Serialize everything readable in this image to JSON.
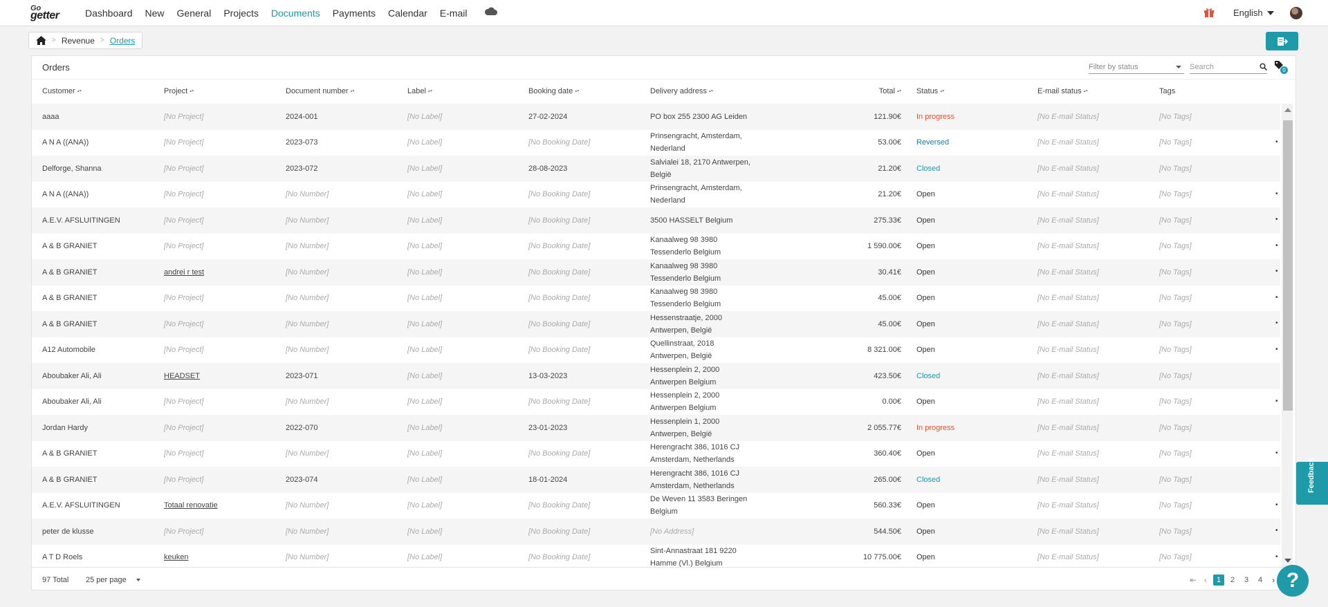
{
  "nav": {
    "logo_top": "Go",
    "logo_bottom": "getter",
    "items": [
      "Dashboard",
      "New",
      "General",
      "Projects",
      "Documents",
      "Payments",
      "Calendar",
      "E-mail"
    ],
    "active": "Documents",
    "language": "English"
  },
  "breadcrumb": {
    "items": [
      "Revenue",
      "Orders"
    ]
  },
  "panel": {
    "title": "Orders",
    "filter_placeholder": "Filter by status",
    "search_placeholder": "Search",
    "tag_filter_count": "0"
  },
  "columns": [
    "Customer",
    "Project",
    "Document number",
    "Label",
    "Booking date",
    "Delivery address",
    "Total",
    "Status",
    "E-mail status",
    "Tags"
  ],
  "rows": [
    {
      "customer": "aaaa",
      "project": "[No Project]",
      "project_link": false,
      "doc": "2024-001",
      "label": "[No Label]",
      "booking": "27-02-2024",
      "address": "PO box 255 2300 AG Leiden",
      "total": "121.90€",
      "status": "In progress",
      "email": "[No E-mail Status]",
      "tags": "[No Tags]",
      "mark": ""
    },
    {
      "customer": "A N A ((ANA))",
      "project": "[No Project]",
      "project_link": false,
      "doc": "2023-073",
      "label": "[No Label]",
      "booking": "[No Booking Date]",
      "address": "Prinsengracht, Amsterdam, Nederland",
      "total": "53.00€",
      "status": "Reversed",
      "email": "[No E-mail Status]",
      "tags": "[No Tags]",
      "mark": "•"
    },
    {
      "customer": "Delforge, Shanna",
      "project": "[No Project]",
      "project_link": false,
      "doc": "2023-072",
      "label": "[No Label]",
      "booking": "28-08-2023",
      "address": "Salvialei 18, 2170 Antwerpen, België",
      "total": "21.20€",
      "status": "Closed",
      "email": "[No E-mail Status]",
      "tags": "[No Tags]",
      "mark": ""
    },
    {
      "customer": "A N A ((ANA))",
      "project": "[No Project]",
      "project_link": false,
      "doc": "[No Number]",
      "label": "[No Label]",
      "booking": "[No Booking Date]",
      "address": "Prinsengracht, Amsterdam, Nederland",
      "total": "21.20€",
      "status": "Open",
      "email": "[No E-mail Status]",
      "tags": "[No Tags]",
      "mark": "•"
    },
    {
      "customer": "A.E.V. AFSLUITINGEN",
      "project": "[No Project]",
      "project_link": false,
      "doc": "[No Number]",
      "label": "[No Label]",
      "booking": "[No Booking Date]",
      "address": "3500 HASSELT Belgium",
      "total": "275.33€",
      "status": "Open",
      "email": "[No E-mail Status]",
      "tags": "[No Tags]",
      "mark": "•"
    },
    {
      "customer": "A & B GRANIET",
      "project": "[No Project]",
      "project_link": false,
      "doc": "[No Number]",
      "label": "[No Label]",
      "booking": "[No Booking Date]",
      "address": "Kanaalweg 98 3980 Tessenderlo Belgium",
      "total": "1 590.00€",
      "status": "Open",
      "email": "[No E-mail Status]",
      "tags": "[No Tags]",
      "mark": "•"
    },
    {
      "customer": "A & B GRANIET",
      "project": "andrei r test",
      "project_link": true,
      "doc": "[No Number]",
      "label": "[No Label]",
      "booking": "[No Booking Date]",
      "address": "Kanaalweg 98 3980 Tessenderlo Belgium",
      "total": "30.41€",
      "status": "Open",
      "email": "[No E-mail Status]",
      "tags": "[No Tags]",
      "mark": "•"
    },
    {
      "customer": "A & B GRANIET",
      "project": "[No Project]",
      "project_link": false,
      "doc": "[No Number]",
      "label": "[No Label]",
      "booking": "[No Booking Date]",
      "address": "Kanaalweg 98 3980 Tessenderlo Belgium",
      "total": "45.00€",
      "status": "Open",
      "email": "[No E-mail Status]",
      "tags": "[No Tags]",
      "mark": "•"
    },
    {
      "customer": "A & B GRANIET",
      "project": "[No Project]",
      "project_link": false,
      "doc": "[No Number]",
      "label": "[No Label]",
      "booking": "[No Booking Date]",
      "address": "Hessenstraatje, 2000 Antwerpen, België",
      "total": "45.00€",
      "status": "Open",
      "email": "[No E-mail Status]",
      "tags": "[No Tags]",
      "mark": "•"
    },
    {
      "customer": "A12 Automobile",
      "project": "[No Project]",
      "project_link": false,
      "doc": "[No Number]",
      "label": "[No Label]",
      "booking": "[No Booking Date]",
      "address": "Quellinstraat, 2018 Antwerpen, België",
      "total": "8 321.00€",
      "status": "Open",
      "email": "[No E-mail Status]",
      "tags": "[No Tags]",
      "mark": "•"
    },
    {
      "customer": "Aboubaker Ali, Ali",
      "project": "HEADSET",
      "project_link": true,
      "doc": "2023-071",
      "label": "[No Label]",
      "booking": "13-03-2023",
      "address": "Hessenplein 2, 2000 Antwerpen Belgium",
      "total": "423.50€",
      "status": "Closed",
      "email": "[No E-mail Status]",
      "tags": "[No Tags]",
      "mark": ""
    },
    {
      "customer": "Aboubaker Ali, Ali",
      "project": "[No Project]",
      "project_link": false,
      "doc": "[No Number]",
      "label": "[No Label]",
      "booking": "[No Booking Date]",
      "address": "Hessenplein 2, 2000 Antwerpen Belgium",
      "total": "0.00€",
      "status": "Open",
      "email": "[No E-mail Status]",
      "tags": "[No Tags]",
      "mark": "•"
    },
    {
      "customer": "Jordan Hardy",
      "project": "[No Project]",
      "project_link": false,
      "doc": "2022-070",
      "label": "[No Label]",
      "booking": "23-01-2023",
      "address": "Hessenplein 1, 2000 Antwerpen, België",
      "total": "2 055.77€",
      "status": "In progress",
      "email": "[No E-mail Status]",
      "tags": "[No Tags]",
      "mark": ""
    },
    {
      "customer": "A & B GRANIET",
      "project": "[No Project]",
      "project_link": false,
      "doc": "[No Number]",
      "label": "[No Label]",
      "booking": "[No Booking Date]",
      "address": "Herengracht 386, 1016 CJ Amsterdam, Netherlands",
      "total": "360.40€",
      "status": "Open",
      "email": "[No E-mail Status]",
      "tags": "[No Tags]",
      "mark": "•"
    },
    {
      "customer": "A & B GRANIET",
      "project": "[No Project]",
      "project_link": false,
      "doc": "2023-074",
      "label": "[No Label]",
      "booking": "18-01-2024",
      "address": "Herengracht 386, 1016 CJ Amsterdam, Netherlands",
      "total": "265.00€",
      "status": "Closed",
      "email": "[No E-mail Status]",
      "tags": "[No Tags]",
      "mark": ""
    },
    {
      "customer": "A.E.V. AFSLUITINGEN",
      "project": "Totaal renovatie",
      "project_link": true,
      "doc": "[No Number]",
      "label": "[No Label]",
      "booking": "[No Booking Date]",
      "address": "De Weven 11 3583 Beringen Belgium",
      "total": "560.33€",
      "status": "Open",
      "email": "[No E-mail Status]",
      "tags": "[No Tags]",
      "mark": "•"
    },
    {
      "customer": "peter de klusse",
      "project": "[No Project]",
      "project_link": false,
      "doc": "[No Number]",
      "label": "[No Label]",
      "booking": "[No Booking Date]",
      "address": "[No Address]",
      "total": "544.50€",
      "status": "Open",
      "email": "[No E-mail Status]",
      "tags": "[No Tags]",
      "mark": "•"
    },
    {
      "customer": "A T D Roels",
      "project": "keuken",
      "project_link": true,
      "doc": "[No Number]",
      "label": "[No Label]",
      "booking": "[No Booking Date]",
      "address": "Sint-Annastraat 181 9220 Hamme (Vl.) Belgium",
      "total": "10 775.00€",
      "status": "Open",
      "email": "[No E-mail Status]",
      "tags": "[No Tags]",
      "mark": "•"
    }
  ],
  "footer": {
    "total": "97 Total",
    "per_page": "25 per page",
    "pages": [
      "1",
      "2",
      "3",
      "4"
    ],
    "current_page": "1"
  },
  "feedback_label": "Feedback",
  "help_label": "?",
  "colors": {
    "accent": "#1e9aa8",
    "in_progress": "#e5533c",
    "reversed": "#1e7aa8"
  }
}
